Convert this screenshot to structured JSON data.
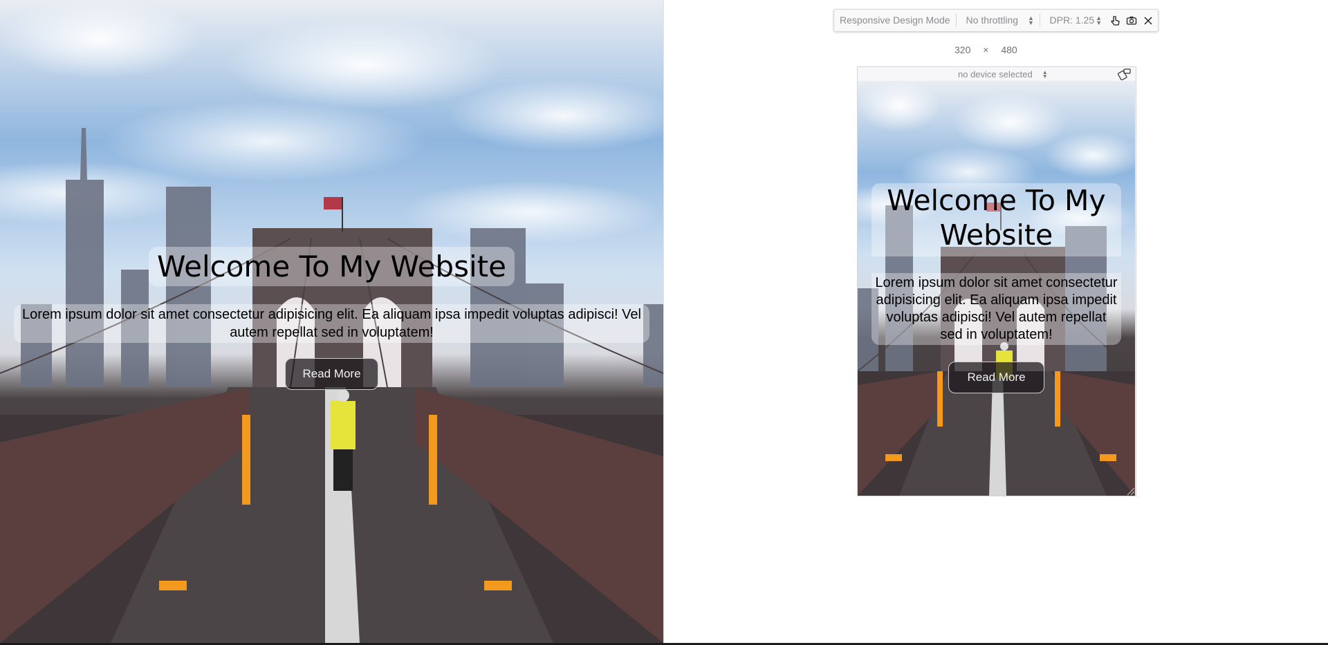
{
  "page": {
    "heading": "Welcome To My Website",
    "description": "Lorem ipsum dolor sit amet consectetur adipisicing elit. Ea aliquam ipsa impedit voluptas adipisci! Vel autem repellat sed in voluptatem!",
    "button_label": "Read More"
  },
  "rdm_toolbar": {
    "title": "Responsive Design Mode",
    "throttling": "No throttling",
    "dpr": "DPR: 1.25",
    "icons": [
      "touch-simulation-icon",
      "screenshot-icon",
      "close-icon"
    ]
  },
  "viewport": {
    "width": "320",
    "separator": "×",
    "height": "480"
  },
  "device_selector": {
    "value": "no device selected",
    "icon": "rotate-viewport-icon"
  },
  "colors": {
    "overlay": "#ffffff",
    "button_bg": "#1e1a1c",
    "toolbar_bg": "#f9f9fa",
    "bridge": "#3b3538",
    "safety_orange": "#f39a1e"
  }
}
